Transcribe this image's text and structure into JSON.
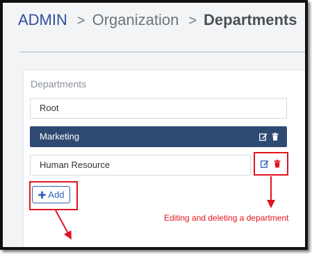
{
  "breadcrumb": {
    "root": "ADMIN",
    "middle": "Organization",
    "current": "Departments",
    "separator": ">"
  },
  "card": {
    "title": "Departments"
  },
  "departments": [
    {
      "label": "Root",
      "selected": false
    },
    {
      "label": "Marketing",
      "selected": true
    },
    {
      "label": "Human Resource",
      "selected": false
    }
  ],
  "actions": {
    "add_label": "Add",
    "add_icon": "plus-icon",
    "edit_icon": "edit-icon",
    "delete_icon": "trash-icon"
  },
  "annotation": {
    "text": "Editing and deleting a department"
  },
  "colors": {
    "accent": "#2f4e9e",
    "selected_row": "#2e4a73",
    "highlight": "#e0141e"
  }
}
